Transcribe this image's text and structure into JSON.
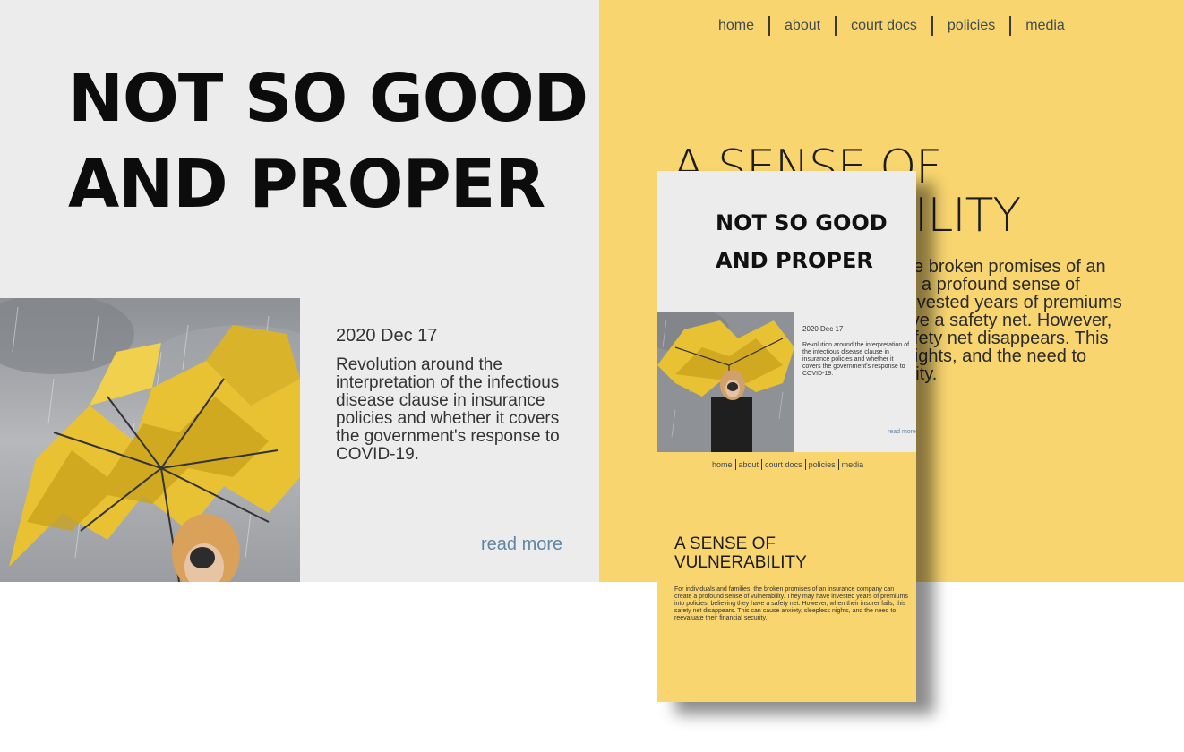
{
  "site": {
    "title_lines": [
      "NOT SO GOOD",
      "AND PROPER"
    ]
  },
  "nav": {
    "items": [
      "home",
      "about",
      "court docs",
      "policies",
      "media"
    ]
  },
  "post": {
    "date": "2020 Dec 17",
    "excerpt": "Revolution around the interpretation of the infectious disease clause in insurance policies and whether it covers the government's response to COVID-19.",
    "read_more": "read more",
    "image_icon": "broken-yellow-umbrella-photo"
  },
  "section": {
    "title_lines": [
      "A SENSE OF",
      "VULNERABILITY"
    ],
    "body": "For individuals and families, the broken promises of an insurance company can create a profound sense of vulnerability. They may have invested years of premiums into policies, believing they have a safety net. However, when their insurer fails, this safety net disappears. This can cause anxiety, sleepless nights, and the need to reevaluate their financial security."
  },
  "colors": {
    "left_bg": "#ececec",
    "right_bg": "#f8d56f",
    "link": "#5f86a3"
  }
}
